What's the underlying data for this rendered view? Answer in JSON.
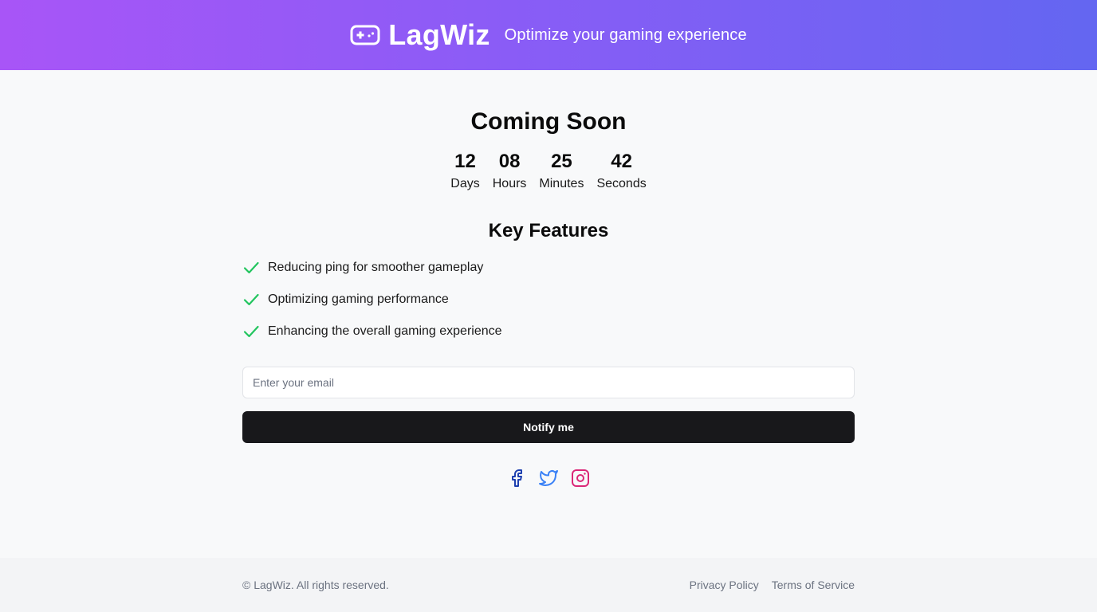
{
  "header": {
    "brand_name": "LagWiz",
    "tagline": "Optimize your gaming experience",
    "brand_icon": "gamepad-icon"
  },
  "main": {
    "title": "Coming Soon",
    "countdown": [
      {
        "value": "12",
        "label": "Days"
      },
      {
        "value": "08",
        "label": "Hours"
      },
      {
        "value": "25",
        "label": "Minutes"
      },
      {
        "value": "42",
        "label": "Seconds"
      }
    ],
    "features_title": "Key Features",
    "features": [
      {
        "text": "Reducing ping for smoother gameplay",
        "icon": "check-icon"
      },
      {
        "text": "Optimizing gaming performance",
        "icon": "check-icon"
      },
      {
        "text": "Enhancing the overall gaming experience",
        "icon": "check-icon"
      }
    ],
    "email": {
      "placeholder": "Enter your email",
      "value": ""
    },
    "notify_label": "Notify me",
    "social": [
      {
        "name": "facebook-icon",
        "color": "#1e40af"
      },
      {
        "name": "twitter-icon",
        "color": "#3b82f6"
      },
      {
        "name": "instagram-icon",
        "color": "#db2777"
      }
    ]
  },
  "footer": {
    "copyright": "© LagWiz. All rights reserved.",
    "links": [
      "Privacy Policy",
      "Terms of Service"
    ]
  },
  "colors": {
    "header_gradient_start": "#a855f7",
    "header_gradient_end": "#6366f1",
    "check": "#22c55e",
    "button": "#18181b"
  }
}
